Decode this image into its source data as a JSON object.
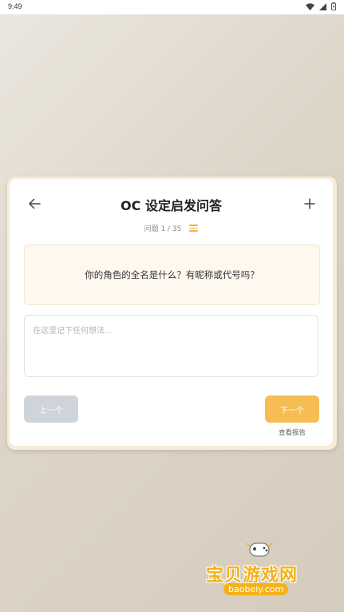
{
  "status_bar": {
    "time": "9:49",
    "icons": [
      "wifi-icon",
      "signal-icon",
      "battery-icon"
    ]
  },
  "header": {
    "title": "OC 设定启发问答",
    "back_icon": "arrow-left-icon",
    "add_icon": "plus-icon"
  },
  "progress": {
    "label": "问题 1 / 35",
    "current": 1,
    "total": 35,
    "menu_icon": "menu-icon"
  },
  "question": {
    "text": "你的角色的全名是什么？有昵称或代号吗？"
  },
  "answer": {
    "value": "",
    "placeholder": "在这里记下任何想法..."
  },
  "buttons": {
    "prev_label": "上一个",
    "next_label": "下一个",
    "report_label": "查看报告"
  },
  "watermark": {
    "text": "宝贝游戏网",
    "url": "baobeiy.com"
  },
  "colors": {
    "accent": "#f6bd54",
    "disabled": "#cfd3da",
    "question_bg": "#fff8ef"
  }
}
